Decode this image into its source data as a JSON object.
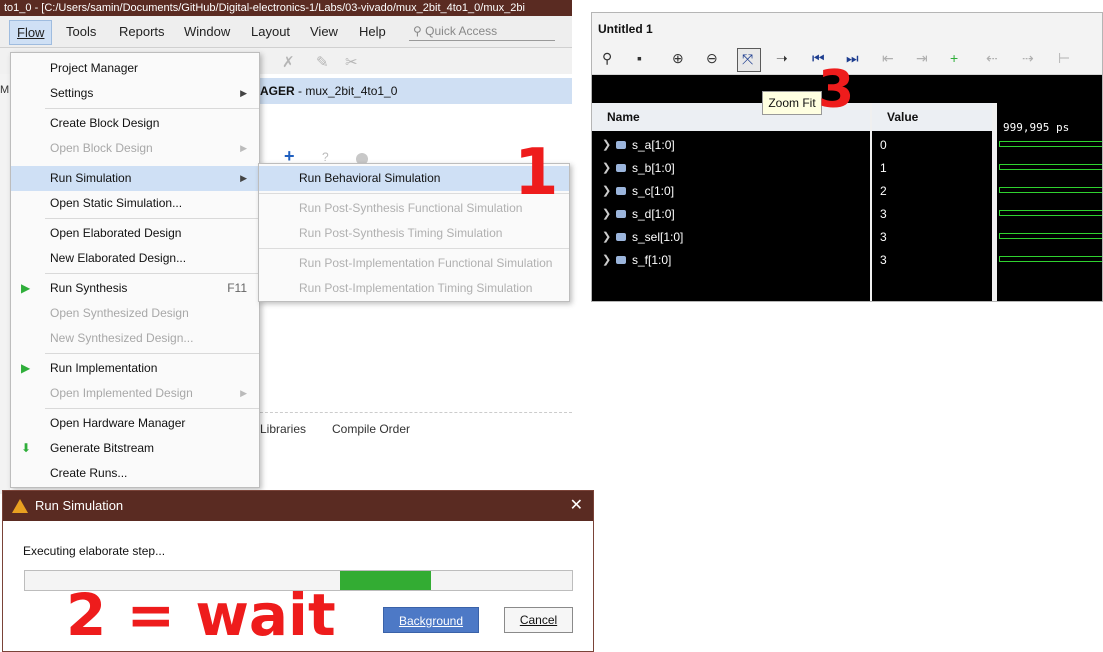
{
  "vivado": {
    "title": "to1_0 - [C:/Users/samin/Documents/GitHub/Digital-electronics-1/Labs/03-vivado/mux_2bit_4to1_0/mux_2bi",
    "menus": [
      "Flow",
      "Tools",
      "Reports",
      "Window",
      "Layout",
      "View",
      "Help"
    ],
    "quick_access": "Quick Access",
    "pm_header_prefix": "AGER",
    "pm_header_rest": " - mux_2bit_4to1_0",
    "tabs": [
      "Libraries",
      "Compile Order"
    ]
  },
  "flow_menu": {
    "items": [
      {
        "label": "Project Manager",
        "disabled": false
      },
      {
        "label": "Settings",
        "disabled": false,
        "submenu": true
      },
      {
        "label": "Create Block Design",
        "disabled": false
      },
      {
        "label": "Open Block Design",
        "disabled": true,
        "submenu": true
      },
      {
        "label": "Run Simulation",
        "disabled": false,
        "submenu": true,
        "selected": true
      },
      {
        "label": "Open Static Simulation...",
        "disabled": false
      },
      {
        "label": "Open Elaborated Design",
        "disabled": false
      },
      {
        "label": "New Elaborated Design...",
        "disabled": false
      },
      {
        "label": "Run Synthesis",
        "disabled": false,
        "shortcut": "F11",
        "icon": "play-icon"
      },
      {
        "label": "Open Synthesized Design",
        "disabled": true
      },
      {
        "label": "New Synthesized Design...",
        "disabled": true
      },
      {
        "label": "Run Implementation",
        "disabled": false,
        "icon": "play-icon"
      },
      {
        "label": "Open Implemented Design",
        "disabled": true,
        "submenu": true
      },
      {
        "label": "Open Hardware Manager",
        "disabled": false
      },
      {
        "label": "Generate Bitstream",
        "disabled": false,
        "icon": "bitstream-icon"
      },
      {
        "label": "Create Runs...",
        "disabled": false
      }
    ]
  },
  "sim_submenu": {
    "items": [
      {
        "label": "Run Behavioral Simulation",
        "disabled": false,
        "selected": true
      },
      {
        "label": "Run Post-Synthesis Functional Simulation",
        "disabled": true
      },
      {
        "label": "Run Post-Synthesis Timing Simulation",
        "disabled": true
      },
      {
        "label": "Run Post-Implementation Functional Simulation",
        "disabled": true
      },
      {
        "label": "Run Post-Implementation Timing Simulation",
        "disabled": true
      }
    ]
  },
  "dialog": {
    "title": "Run Simulation",
    "status": "Executing elaborate step...",
    "progress": 0.5,
    "background_button": "Background",
    "cancel_button": "Cancel"
  },
  "annotations": {
    "step1": "1",
    "step2": "2 = wait",
    "step3": "3",
    "color": "#ee1c1c"
  },
  "wave": {
    "title": "Untitled 1",
    "tooltip": "Zoom Fit",
    "name_header": "Name",
    "value_header": "Value",
    "time_label": "999,995 ps",
    "signals": [
      {
        "name": "s_a[1:0]",
        "value": "0"
      },
      {
        "name": "s_b[1:0]",
        "value": "1"
      },
      {
        "name": "s_c[1:0]",
        "value": "2"
      },
      {
        "name": "s_d[1:0]",
        "value": "3"
      },
      {
        "name": "s_sel[1:0]",
        "value": "3"
      },
      {
        "name": "s_f[1:0]",
        "value": "3"
      }
    ],
    "trace_color": "#2fd12f"
  }
}
